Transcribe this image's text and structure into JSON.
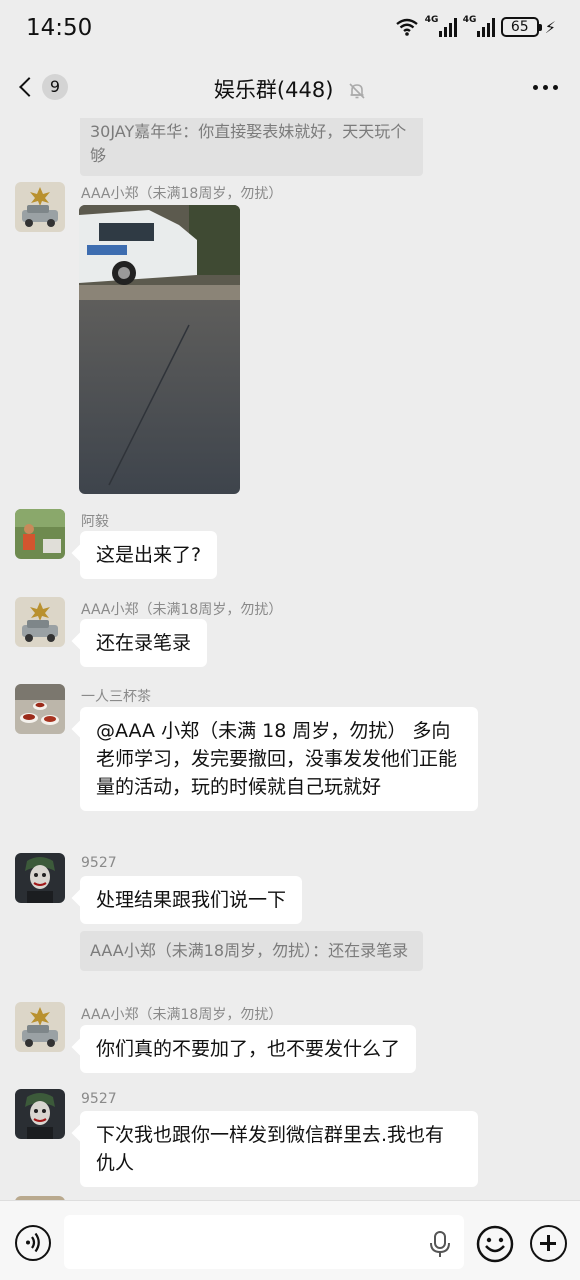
{
  "status_bar": {
    "time": "14:50",
    "network_1": "4G",
    "network_2": "4G",
    "battery": "65"
  },
  "header": {
    "unread_count": "9",
    "title": "娱乐群(448)"
  },
  "chat": {
    "top_quote": "30JAY嘉年华：你直接娶表妹就好，天天玩个够",
    "messages": [
      {
        "sender": "AAA小郑（未满18周岁，勿扰）",
        "type": "image"
      },
      {
        "sender": "阿毅",
        "text": "这是出来了?"
      },
      {
        "sender": "AAA小郑（未满18周岁，勿扰）",
        "text": "还在录笔录"
      },
      {
        "sender": "一人三杯茶",
        "text": "@AAA 小郑（未满 18 周岁，勿扰） 多向老师学习，发完要撤回，没事发发他们正能量的活动，玩的时候就自己玩就好"
      },
      {
        "sender": "9527",
        "text": "处理结果跟我们说一下",
        "quote": "AAA小郑（未满18周岁，勿扰）：还在录笔录"
      },
      {
        "sender": "AAA小郑（未满18周岁，勿扰）",
        "text": "你们真的不要加了，也不要发什么了"
      },
      {
        "sender": "9527",
        "text": "下次我也跟你一样发到微信群里去.我也有仇人"
      }
    ]
  },
  "input_bar": {
    "placeholder": ""
  },
  "colors": {
    "background": "#ededed",
    "bubble": "#ffffff",
    "quote_bg": "#e1e1e1",
    "sender_text": "#8a8a8a"
  }
}
